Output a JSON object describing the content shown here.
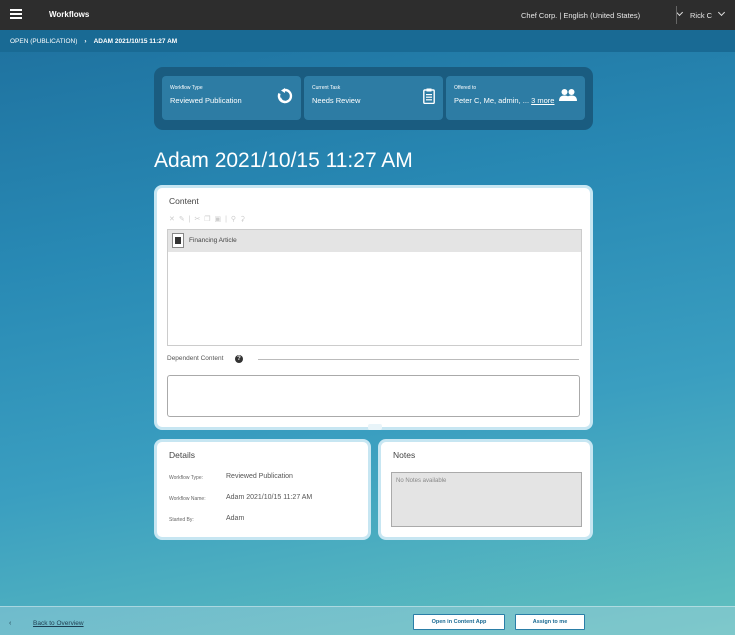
{
  "header": {
    "app_title": "Workflows",
    "org_lang": "Chef Corp. | English (United States)",
    "user": "Rick C"
  },
  "breadcrumb": {
    "parent": "OPEN (PUBLICATION)",
    "separator": "›",
    "current": "ADAM 2021/10/15 11:27 AM"
  },
  "summary": {
    "workflow_type": {
      "label": "Workflow Type",
      "value": "Reviewed Publication",
      "icon": "refresh-icon"
    },
    "current_task": {
      "label": "Current Task",
      "value": "Needs Review",
      "icon": "clipboard-icon"
    },
    "offered_to": {
      "label": "Offered to",
      "value": "Peter C, Me, admin, ...",
      "more": "3 more",
      "icon": "users-icon"
    }
  },
  "page_title": "Adam 2021/10/15 11:27 AM",
  "content_panel": {
    "heading": "Content",
    "toolbar_icons": [
      "remove-icon",
      "edit-icon",
      "cut-icon",
      "copy-icon",
      "paste-icon",
      "link-icon",
      "unlink-icon"
    ],
    "items": [
      {
        "label": "Financing Article",
        "icon": "document-icon"
      }
    ],
    "dependent_label": "Dependent Content",
    "help_glyph": "?"
  },
  "details": {
    "heading": "Details",
    "rows": [
      {
        "label": "Workflow Type:",
        "value": "Reviewed Publication"
      },
      {
        "label": "Workflow Name:",
        "value": "Adam 2021/10/15 11:27 AM"
      },
      {
        "label": "Started By:",
        "value": "Adam"
      }
    ]
  },
  "notes": {
    "heading": "Notes",
    "empty": "No Notes available"
  },
  "footer": {
    "back_chevron": "‹",
    "back_label": "Back to Overview",
    "open_button": "Open in Content App",
    "assign_button": "Assign to me"
  },
  "colors": {
    "topbar": "#2d2d2d",
    "breadcrumb_bar": "#196a94",
    "summary_bg": "#1a5c80",
    "summary_card": "#2d7ca4",
    "panel_border": "#c7e6f2",
    "button_text": "#1a6a93"
  }
}
